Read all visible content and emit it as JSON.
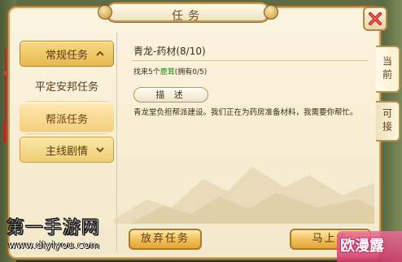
{
  "window": {
    "title": "任务"
  },
  "close_button": {
    "icon": "close-icon"
  },
  "categories": [
    {
      "label": "常规任务",
      "type": "main",
      "expanded": true,
      "icon": "chevron-up-icon"
    },
    {
      "label": "平定安邦任务",
      "type": "sub",
      "selected": false
    },
    {
      "label": "帮派任务",
      "type": "sub",
      "selected": true
    },
    {
      "label": "主线剧情",
      "type": "main",
      "expanded": false,
      "icon": "chevron-down-icon"
    }
  ],
  "quest": {
    "title": "青龙-药材(8/10)",
    "requirement_prefix": "找来5个",
    "requirement_item": "鹿茸",
    "requirement_suffix": "(拥有0/5)",
    "description_tag": "描 述",
    "description": "青龙堂负担帮派建设。我们正在为药房准备材料，我需要你帮忙。"
  },
  "side_tabs": [
    {
      "label": "当前",
      "active": true
    },
    {
      "label": "可接",
      "active": false
    }
  ],
  "buttons": {
    "abandon": "放弃任务",
    "go": "马上传"
  },
  "watermarks": {
    "site_cn": "第一手游网",
    "site_url": "www.diyiyou.com",
    "brand": "欧漫露"
  },
  "colors": {
    "panel_bg": "#f3e8cb",
    "button_gold": "#f2be56",
    "highlight_green": "#2f8a1e",
    "text_brown": "#5b3a16"
  }
}
